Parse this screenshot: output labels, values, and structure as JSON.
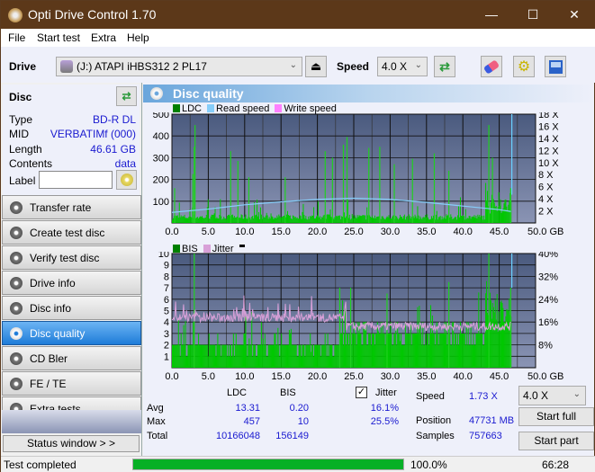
{
  "window": {
    "title": "Opti Drive Control 1.70",
    "minimize": "—",
    "maximize": "☐",
    "close": "✕"
  },
  "menu": [
    "File",
    "Start test",
    "Extra",
    "Help"
  ],
  "toolbar": {
    "drive_label": "Drive",
    "drive_value": "(J:)  ATAPI iHBS312  2 PL17",
    "speed_label": "Speed",
    "speed_value": "4.0 X"
  },
  "disc": {
    "header": "Disc",
    "rows": [
      {
        "k": "Type",
        "v": "BD-R DL"
      },
      {
        "k": "MID",
        "v": "VERBATIMf (000)"
      },
      {
        "k": "Length",
        "v": "46.61 GB"
      },
      {
        "k": "Contents",
        "v": "data"
      }
    ],
    "label_label": "Label",
    "label_value": ""
  },
  "nav": [
    {
      "label": "Transfer rate",
      "active": false
    },
    {
      "label": "Create test disc",
      "active": false
    },
    {
      "label": "Verify test disc",
      "active": false
    },
    {
      "label": "Drive info",
      "active": false
    },
    {
      "label": "Disc info",
      "active": false
    },
    {
      "label": "Disc quality",
      "active": true
    },
    {
      "label": "CD Bler",
      "active": false
    },
    {
      "label": "FE / TE",
      "active": false
    },
    {
      "label": "Extra tests",
      "active": false
    }
  ],
  "status_window_label": "Status window > >",
  "main": {
    "title": "Disc quality"
  },
  "chart_data": [
    {
      "type": "bar",
      "title": "LDC / Read speed",
      "legend": [
        "LDC",
        "Read speed",
        "Write speed"
      ],
      "legend_colors": [
        "#008000",
        "#87cefa",
        "#ff80ff"
      ],
      "xlabel": "GB",
      "xlim": [
        0,
        50
      ],
      "x_ticks": [
        "0.0",
        "5.0",
        "10.0",
        "15.0",
        "20.0",
        "25.0",
        "30.0",
        "35.0",
        "40.0",
        "45.0",
        "50.0 GB"
      ],
      "ylim": [
        0,
        500
      ],
      "y_ticks": [
        "100",
        "200",
        "300",
        "400",
        "500"
      ],
      "y2lim": [
        0,
        18
      ],
      "y2_ticks": [
        "2 X",
        "4 X",
        "6 X",
        "8 X",
        "10 X",
        "12 X",
        "14 X",
        "16 X",
        "18 X"
      ],
      "ldc_peaks": [
        {
          "x": 0.3,
          "y": 160
        },
        {
          "x": 2.8,
          "y": 225
        },
        {
          "x": 3.0,
          "y": 350
        },
        {
          "x": 3.1,
          "y": 450
        },
        {
          "x": 8.0,
          "y": 330
        },
        {
          "x": 9.0,
          "y": 285
        },
        {
          "x": 10.5,
          "y": 210
        },
        {
          "x": 15.5,
          "y": 210
        },
        {
          "x": 21.0,
          "y": 330
        },
        {
          "x": 22.0,
          "y": 300
        },
        {
          "x": 23.5,
          "y": 360
        },
        {
          "x": 24.0,
          "y": 395
        },
        {
          "x": 27.0,
          "y": 345
        },
        {
          "x": 28.5,
          "y": 350
        },
        {
          "x": 30.5,
          "y": 270
        },
        {
          "x": 33.0,
          "y": 295
        },
        {
          "x": 36.0,
          "y": 320
        },
        {
          "x": 38.0,
          "y": 240
        },
        {
          "x": 43.5,
          "y": 450
        },
        {
          "x": 44.0,
          "y": 300
        },
        {
          "x": 46.5,
          "y": 160
        }
      ],
      "read_speed": [
        {
          "x": 0,
          "y": 1.75
        },
        {
          "x": 5,
          "y": 2.3
        },
        {
          "x": 10,
          "y": 3.0
        },
        {
          "x": 15,
          "y": 3.5
        },
        {
          "x": 20,
          "y": 3.9
        },
        {
          "x": 25,
          "y": 4.1
        },
        {
          "x": 30,
          "y": 3.9
        },
        {
          "x": 35,
          "y": 3.4
        },
        {
          "x": 40,
          "y": 2.8
        },
        {
          "x": 45,
          "y": 2.2
        },
        {
          "x": 46.6,
          "y": 1.9
        }
      ],
      "end_marker_x": 46.61
    },
    {
      "type": "bar",
      "title": "BIS / Jitter",
      "legend": [
        "BIS",
        "Jitter"
      ],
      "legend_colors": [
        "#008000",
        "#d8a0d8"
      ],
      "xlabel": "GB",
      "xlim": [
        0,
        50
      ],
      "x_ticks": [
        "0.0",
        "5.0",
        "10.0",
        "15.0",
        "20.0",
        "25.0",
        "30.0",
        "35.0",
        "40.0",
        "45.0",
        "50.0 GB"
      ],
      "ylim": [
        0,
        10
      ],
      "y_ticks": [
        "1",
        "2",
        "3",
        "4",
        "5",
        "6",
        "7",
        "8",
        "9",
        "10"
      ],
      "y2lim": [
        0,
        40
      ],
      "y2_ticks": [
        "8%",
        "16%",
        "24%",
        "32%",
        "40%"
      ],
      "bis_peaks": [
        {
          "x": 3.0,
          "y": 10
        },
        {
          "x": 23.0,
          "y": 7
        },
        {
          "x": 24.5,
          "y": 7
        },
        {
          "x": 29.5,
          "y": 6.5
        },
        {
          "x": 38.0,
          "y": 7.5
        },
        {
          "x": 43.5,
          "y": 10
        },
        {
          "x": 46.5,
          "y": 7
        }
      ],
      "jitter_pct": [
        {
          "x": 0,
          "y": 18
        },
        {
          "x": 5,
          "y": 18.5
        },
        {
          "x": 10,
          "y": 18
        },
        {
          "x": 15,
          "y": 18
        },
        {
          "x": 20,
          "y": 18
        },
        {
          "x": 25,
          "y": 14
        },
        {
          "x": 30,
          "y": 15
        },
        {
          "x": 35,
          "y": 14
        },
        {
          "x": 40,
          "y": 14
        },
        {
          "x": 45,
          "y": 15
        },
        {
          "x": 46.6,
          "y": 14
        }
      ],
      "end_marker_x": 46.61
    }
  ],
  "stats": {
    "col_ldc": "LDC",
    "col_bis": "BIS",
    "jitter_label": "Jitter",
    "jitter_checked": true,
    "rows": [
      {
        "k": "Avg",
        "ldc": "13.31",
        "bis": "0.20",
        "jit": "16.1%"
      },
      {
        "k": "Max",
        "ldc": "457",
        "bis": "10",
        "jit": "25.5%"
      },
      {
        "k": "Total",
        "ldc": "10166048",
        "bis": "156149",
        "jit": ""
      }
    ],
    "speed_label": "Speed",
    "speed_value": "1.73 X",
    "position_label": "Position",
    "position_value": "47731 MB",
    "samples_label": "Samples",
    "samples_value": "757663",
    "speed_select": "4.0 X",
    "start_full": "Start full",
    "start_part": "Start part"
  },
  "status": {
    "text": "Test completed",
    "progress": 100.0,
    "progress_text": "100.0%",
    "time": "66:28"
  }
}
